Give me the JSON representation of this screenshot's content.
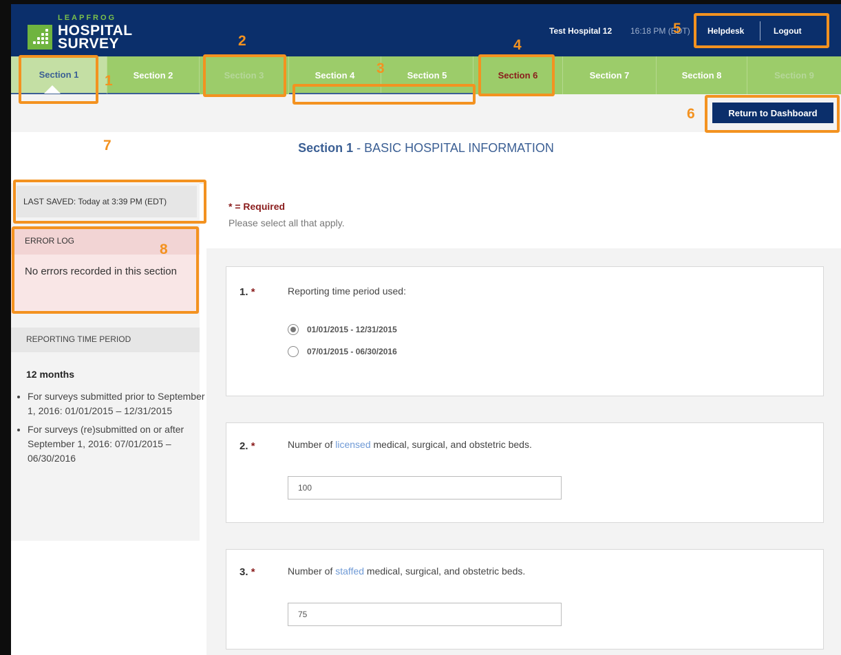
{
  "header": {
    "logo_top": "LEAPFROG",
    "logo_line1": "HOSPITAL",
    "logo_line2": "SURVEY",
    "hospital_name": "Test Hospital 12",
    "time": "16:18 PM (EDT)",
    "helpdesk": "Helpdesk",
    "logout": "Logout"
  },
  "nav": {
    "tabs": [
      {
        "label": "Section 1",
        "state": "active"
      },
      {
        "label": "Section 2",
        "state": "normal"
      },
      {
        "label": "Section 3",
        "state": "disabled"
      },
      {
        "label": "Section 4",
        "state": "normal"
      },
      {
        "label": "Section 5",
        "state": "normal"
      },
      {
        "label": "Section 6",
        "state": "error"
      },
      {
        "label": "Section 7",
        "state": "normal"
      },
      {
        "label": "Section 8",
        "state": "normal"
      },
      {
        "label": "Section 9",
        "state": "disabled"
      }
    ]
  },
  "actions": {
    "return_dashboard": "Return to Dashboard"
  },
  "page": {
    "section": "Section 1",
    "title_rest": " - BASIC HOSPITAL INFORMATION"
  },
  "sidebar": {
    "last_saved": "LAST SAVED: Today at 3:39 PM (EDT)",
    "error_log_title": "ERROR LOG",
    "error_log_body": "No errors recorded in this section",
    "rtp_title": "REPORTING TIME PERIOD",
    "rtp_subtitle": "12 months",
    "rtp_items": [
      "For surveys submitted prior to September 1, 2016: 01/01/2015 – 12/31/2015",
      "For surveys (re)submitted on or after September 1, 2016: 07/01/2015 – 06/30/2016"
    ]
  },
  "main": {
    "required_note": "* = Required",
    "select_note": "Please select all that apply.",
    "q1": {
      "num": "1.",
      "star": "*",
      "text": "Reporting time period used:",
      "options": [
        "01/01/2015 - 12/31/2015",
        "07/01/2015 - 06/30/2016"
      ],
      "selected": 0
    },
    "q2": {
      "num": "2.",
      "star": "*",
      "text_pre": "Number of ",
      "text_link": "licensed",
      "text_post": " medical, surgical, and obstetric beds.",
      "value": "100"
    },
    "q3": {
      "num": "3.",
      "star": "*",
      "text_pre": "Number of ",
      "text_link": "staffed",
      "text_post": " medical, surgical, and obstetric beds.",
      "value": "75"
    }
  },
  "annotations": [
    "1",
    "2",
    "3",
    "4",
    "5",
    "6",
    "7",
    "8"
  ],
  "colors": {
    "header_bg": "#0b2f6b",
    "nav_green": "#9ccc6a",
    "annotation_orange": "#f39220",
    "required_red": "#8a1c1c",
    "link_blue": "#6f9ad6"
  }
}
